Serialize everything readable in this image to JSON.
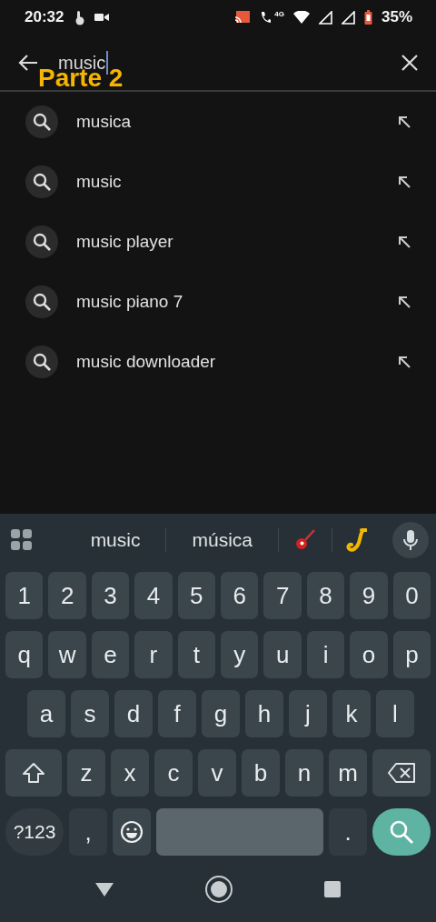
{
  "status_bar": {
    "time": "20:32",
    "network_label": "4G",
    "battery": "35%"
  },
  "search": {
    "value": "music"
  },
  "overlay_caption": "Parte 2",
  "suggestions": [
    {
      "text": "musica"
    },
    {
      "text": "music"
    },
    {
      "text": "music player"
    },
    {
      "text": "music piano 7"
    },
    {
      "text": "music downloader"
    }
  ],
  "keyboard": {
    "word_suggestions": [
      "music",
      "música"
    ],
    "rows": [
      [
        "1",
        "2",
        "3",
        "4",
        "5",
        "6",
        "7",
        "8",
        "9",
        "0"
      ],
      [
        "q",
        "w",
        "e",
        "r",
        "t",
        "y",
        "u",
        "i",
        "o",
        "p"
      ],
      [
        "a",
        "s",
        "d",
        "f",
        "g",
        "h",
        "j",
        "k",
        "l"
      ],
      [
        "z",
        "x",
        "c",
        "v",
        "b",
        "n",
        "m"
      ]
    ],
    "symbols_key": "?123",
    "comma_key": ",",
    "period_key": "."
  }
}
